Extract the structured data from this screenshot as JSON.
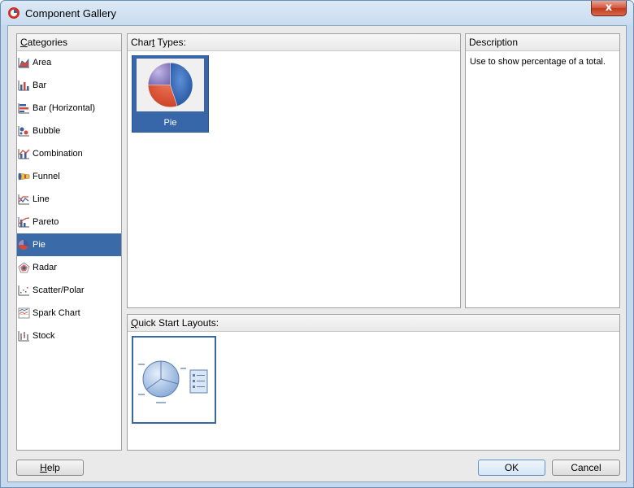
{
  "window": {
    "title": "Component Gallery",
    "close_symbol": "x"
  },
  "categories": {
    "header": "Categories",
    "header_mnemonic": "C",
    "header_rest": "ategories",
    "selected": "Pie",
    "items": [
      {
        "label": "Area",
        "icon": "area-chart-icon"
      },
      {
        "label": "Bar",
        "icon": "bar-chart-icon"
      },
      {
        "label": "Bar (Horizontal)",
        "icon": "horizontal-bar-chart-icon"
      },
      {
        "label": "Bubble",
        "icon": "bubble-chart-icon"
      },
      {
        "label": "Combination",
        "icon": "combination-chart-icon"
      },
      {
        "label": "Funnel",
        "icon": "funnel-chart-icon"
      },
      {
        "label": "Line",
        "icon": "line-chart-icon"
      },
      {
        "label": "Pareto",
        "icon": "pareto-chart-icon"
      },
      {
        "label": "Pie",
        "icon": "pie-chart-icon"
      },
      {
        "label": "Radar",
        "icon": "radar-chart-icon"
      },
      {
        "label": "Scatter/Polar",
        "icon": "scatter-chart-icon"
      },
      {
        "label": "Spark Chart",
        "icon": "spark-chart-icon"
      },
      {
        "label": "Stock",
        "icon": "stock-chart-icon"
      }
    ]
  },
  "chart_types": {
    "header": "Chart Types:",
    "header_pre": "Char",
    "header_mnemonic": "t",
    "header_post": " Types:",
    "tiles": [
      {
        "label": "Pie",
        "icon": "pie-chart-thumbnail-icon"
      }
    ]
  },
  "description": {
    "header": "Description",
    "text": "Use to show percentage of a total."
  },
  "quick_start": {
    "header": "Quick Start Layouts:",
    "header_mnemonic": "Q",
    "header_rest": "uick Start Layouts:",
    "tiles": [
      {
        "icon": "pie-with-legend-layout-icon"
      }
    ]
  },
  "buttons": {
    "help": "Help",
    "help_mnemonic": "H",
    "help_rest": "elp",
    "ok": "OK",
    "cancel": "Cancel"
  },
  "colors": {
    "selection": "#3a6aa8",
    "title_bar": "#c9dcef",
    "close_button": "#c23a20"
  }
}
